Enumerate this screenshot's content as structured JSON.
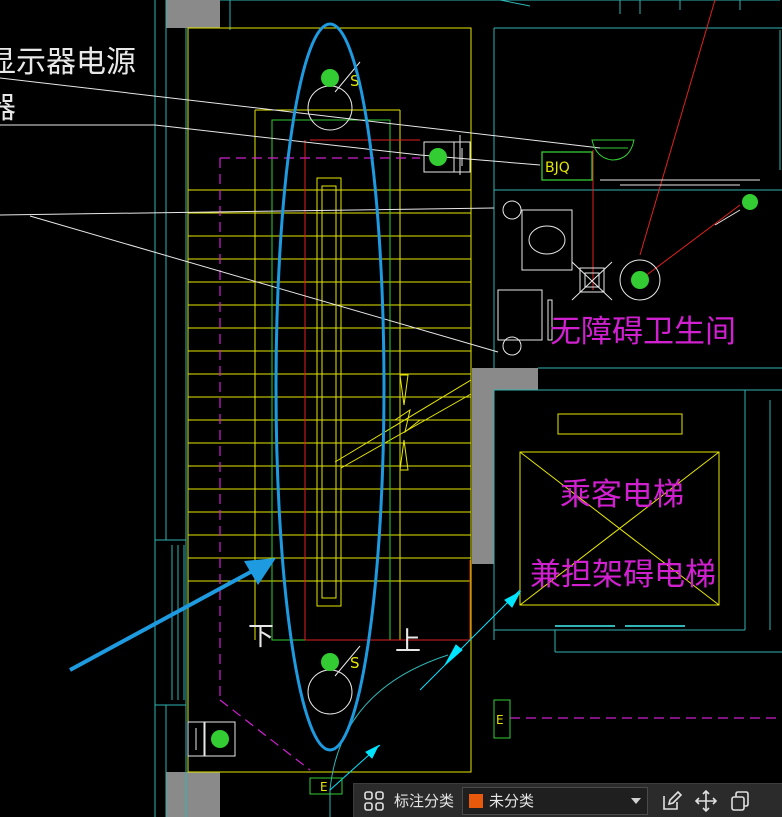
{
  "drawing": {
    "labels": {
      "monitor_power": "显示器电源",
      "partial_left": "器",
      "accessible_toilet": "无障碍卫生间",
      "passenger_elevator": "乘客电梯",
      "accessible_elevator": "兼担架碍电梯",
      "stair_down": "下",
      "stair_up": "上",
      "bjq": "BJQ",
      "s_top": "S",
      "s_bottom": "S",
      "e_left": "E",
      "e_bottom": "E"
    },
    "colors": {
      "background": "#000000",
      "cad_yellow": "#e6e600",
      "cad_cyan": "#2fb5b5",
      "cad_magenta": "#d020d0",
      "cad_green": "#33cc33",
      "cad_red": "#e02020",
      "cad_white": "#e8e8e8",
      "annotation_blue": "#1e9be0",
      "wall_gray": "#8a8a8a"
    }
  },
  "toolbar": {
    "grid_icon": "grid-icon",
    "category_label": "标注分类",
    "category_value": "未分类",
    "category_color": "#e8590c",
    "edit_icon": "edit-icon",
    "move_icon": "move-icon",
    "copy_icon": "copy-icon"
  }
}
